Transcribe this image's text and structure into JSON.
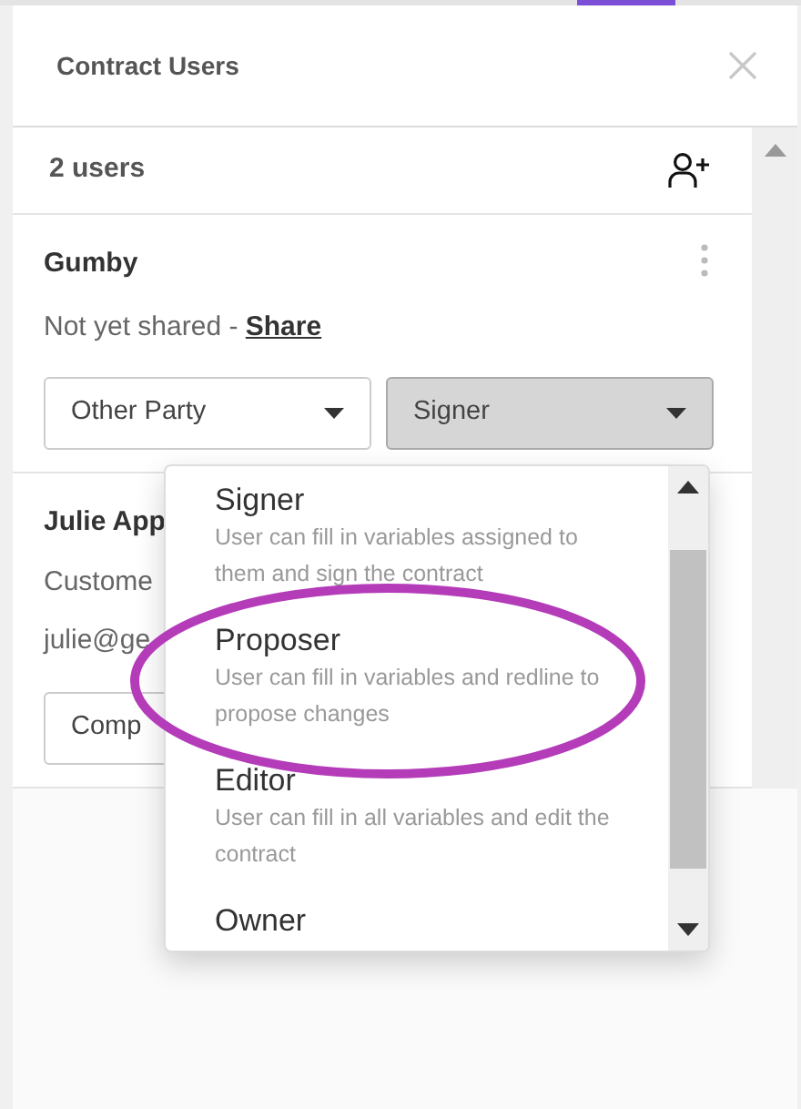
{
  "panel": {
    "title": "Contract Users"
  },
  "user_count": "2 users",
  "users": [
    {
      "name": "Gumby",
      "lines": [
        {
          "kind": "share_status",
          "text": "Not yet shared - ",
          "link": "Share"
        }
      ],
      "party": "Other Party",
      "role": {
        "value": "Signer",
        "open": true
      }
    },
    {
      "name": "Julie App",
      "lines": [
        {
          "kind": "text",
          "text": "Custome"
        },
        {
          "kind": "text",
          "text": "julie@ge"
        }
      ],
      "party": "Comp"
    }
  ],
  "role_menu": {
    "options": [
      {
        "label": "Signer",
        "description": "User can fill in variables assigned to them and sign the contract"
      },
      {
        "label": "Proposer",
        "description": "User can fill in variables and redline to propose changes"
      },
      {
        "label": "Editor",
        "description": "User can fill in all variables and edit the contract"
      },
      {
        "label": "Owner"
      }
    ]
  },
  "annotation": {
    "kind": "ellipse",
    "color": "#b43cb9"
  }
}
